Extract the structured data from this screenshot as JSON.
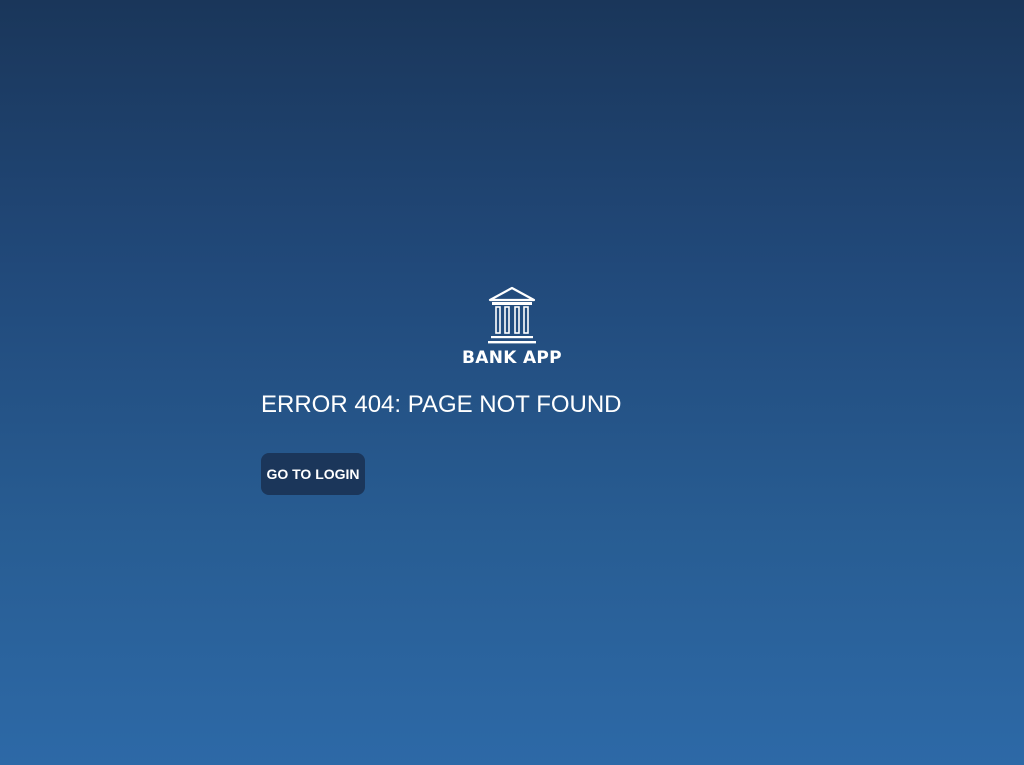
{
  "brand": {
    "name": "BANK APP",
    "icon": "bank-building-icon"
  },
  "error": {
    "title": "ERROR 404: PAGE NOT FOUND"
  },
  "actions": {
    "login_label": "GO TO LOGIN"
  },
  "colors": {
    "background_top": "#1a365a",
    "background_bottom": "#2d69a7",
    "button_bg": "#1b365a",
    "text": "#ffffff"
  }
}
